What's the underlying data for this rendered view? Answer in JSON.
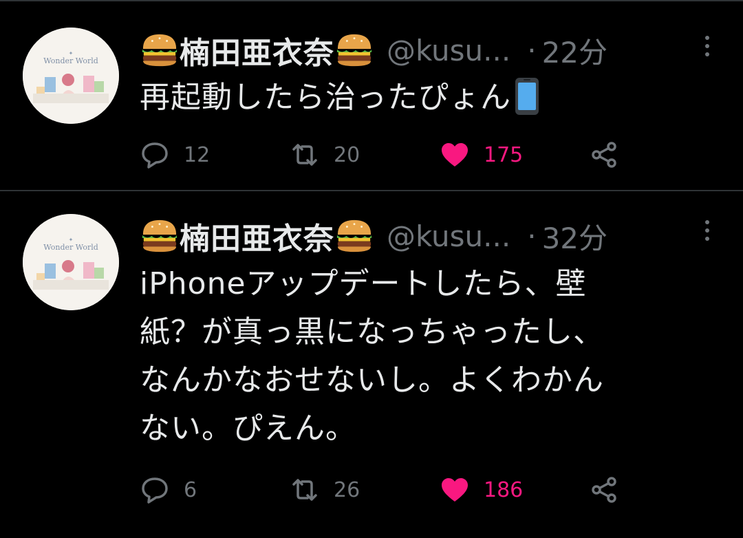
{
  "colors": {
    "background": "#000000",
    "text": "#e7e9ea",
    "muted": "#71767b",
    "like": "#f91880",
    "divider": "#2f3336"
  },
  "tweets": [
    {
      "display_name": "楠田亜衣奈",
      "name_emoji": "hamburger",
      "handle": "@kusu...",
      "time": "22分",
      "text": "再起動したら治ったぴょん",
      "text_emoji": "mobile-phone",
      "replies": "12",
      "retweets": "20",
      "likes": "175",
      "liked": true
    },
    {
      "display_name": "楠田亜衣奈",
      "name_emoji": "hamburger",
      "handle": "@kusu...",
      "time": "32分",
      "text_lines": [
        "iPhoneアップデートしたら、壁",
        "紙？が真っ黒になっちゃったし、",
        "なんかなおせないし。よくわかん",
        "ない。ぴえん。"
      ],
      "replies": "6",
      "retweets": "26",
      "likes": "186",
      "liked": true
    }
  ],
  "avatar": {
    "album_title": "Wonder World"
  }
}
